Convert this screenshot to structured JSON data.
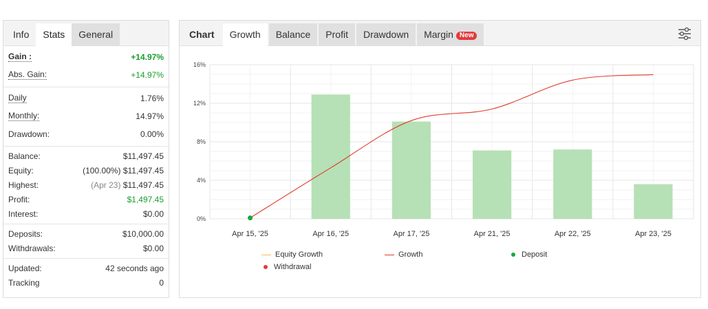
{
  "left": {
    "tabs": [
      {
        "label": "Info"
      },
      {
        "label": "Stats"
      },
      {
        "label": "General"
      }
    ],
    "gain_label": "Gain :",
    "gain_value": "+14.97%",
    "abs_gain_label": "Abs. Gain:",
    "abs_gain_value": "+14.97%",
    "daily_label": "Daily",
    "daily_value": "1.76%",
    "monthly_label": "Monthly:",
    "monthly_value": "14.97%",
    "drawdown_label": "Drawdown:",
    "drawdown_value": "0.00%",
    "balance_label": "Balance:",
    "balance_value": "$11,497.45",
    "equity_label": "Equity:",
    "equity_pct": "(100.00%)",
    "equity_value": "$11,497.45",
    "highest_label": "Highest:",
    "highest_date": "(Apr 23)",
    "highest_value": "$11,497.45",
    "profit_label": "Profit:",
    "profit_value": "$1,497.45",
    "interest_label": "Interest:",
    "interest_value": "$0.00",
    "deposits_label": "Deposits:",
    "deposits_value": "$10,000.00",
    "withdrawals_label": "Withdrawals:",
    "withdrawals_value": "$0.00",
    "updated_label": "Updated:",
    "updated_value": "42 seconds ago",
    "tracking_label": "Tracking",
    "tracking_value": "0"
  },
  "right": {
    "tabs": [
      {
        "label": "Chart"
      },
      {
        "label": "Growth"
      },
      {
        "label": "Balance"
      },
      {
        "label": "Profit"
      },
      {
        "label": "Drawdown"
      },
      {
        "label": "Margin"
      }
    ],
    "margin_badge": "New",
    "settings_icon": "sliders-icon"
  },
  "legend": {
    "equity_growth": "Equity Growth",
    "growth": "Growth",
    "deposit": "Deposit",
    "withdrawal": "Withdrawal"
  },
  "colors": {
    "bar": "#b6e0b5",
    "growth_line": "#e03b2b",
    "equity_line": "#f2c14e",
    "deposit_dot": "#1aa83a",
    "withdrawal_dot": "#e23b3b",
    "gain_green": "#1a9c2e"
  },
  "chart_data": {
    "type": "bar",
    "categories": [
      "Apr 15, '25",
      "Apr 16, '25",
      "Apr 17, '25",
      "Apr 21, '25",
      "Apr 22, '25",
      "Apr 23, '25"
    ],
    "ylim": [
      0,
      16
    ],
    "yticks": [
      "0%",
      "4%",
      "8%",
      "12%",
      "16%"
    ],
    "grid": true,
    "series": [
      {
        "name": "Growth",
        "type": "bar",
        "values": [
          0,
          12.9,
          10.1,
          7.1,
          7.2,
          3.6
        ]
      },
      {
        "name": "Growth",
        "type": "line",
        "values": [
          0.1,
          5.3,
          10.2,
          11.4,
          14.4,
          14.97
        ]
      }
    ],
    "deposit_point": {
      "category": "Apr 15, '25",
      "value": 0.1
    },
    "legend_position": "bottom"
  }
}
